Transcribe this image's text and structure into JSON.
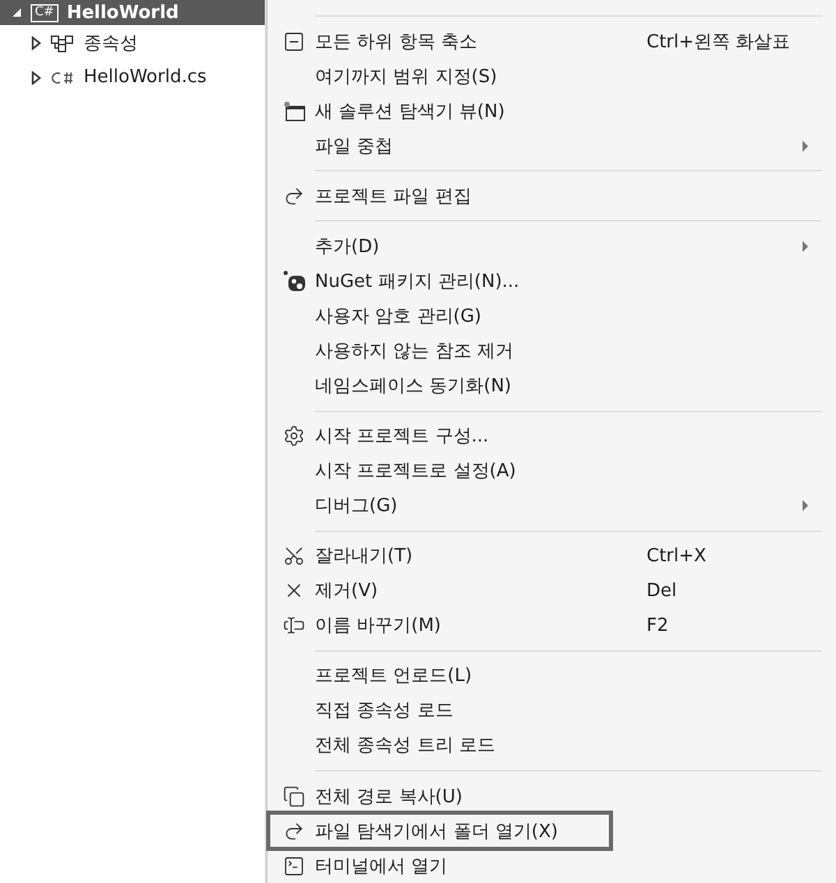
{
  "tree": [
    {
      "label": "HelloWorld",
      "kind": "csproj",
      "badge": "C#",
      "selected": true,
      "expanded": true,
      "children": [
        {
          "label": "종속성",
          "kind": "dependencies",
          "selected": false,
          "expanded": false
        },
        {
          "label": "HelloWorld.cs",
          "kind": "csharp",
          "selected": false,
          "expanded": false
        }
      ]
    }
  ],
  "menu": {
    "groups": [
      [
        {
          "label": "모든 하위 항목 축소",
          "shortcut": "Ctrl+왼쪽 화살표",
          "kind": "collapse"
        },
        {
          "label": "여기까지 범위 지정(S)"
        },
        {
          "label": "새 솔루션 탐색기 뷰(N)",
          "kind": "new-view"
        },
        {
          "label": "파일 중첩",
          "submenu": true
        }
      ],
      [
        {
          "label": "프로젝트 파일 편집",
          "kind": "redo"
        }
      ],
      [
        {
          "label": "추가(D)",
          "submenu": true
        },
        {
          "label": "NuGet 패키지 관리(N)...",
          "kind": "nuget"
        },
        {
          "label": "사용자 암호 관리(G)"
        },
        {
          "label": "사용하지 않는 참조 제거"
        },
        {
          "label": "네임스페이스 동기화(N)"
        }
      ],
      [
        {
          "label": "시작 프로젝트 구성...",
          "kind": "gear"
        },
        {
          "label": "시작 프로젝트로 설정(A)"
        },
        {
          "label": "디버그(G)",
          "submenu": true
        }
      ],
      [
        {
          "label": "잘라내기(T)",
          "shortcut": "Ctrl+X",
          "kind": "cut"
        },
        {
          "label": "제거(V)",
          "shortcut": "Del",
          "kind": "remove"
        },
        {
          "label": "이름 바꾸기(M)",
          "shortcut": "F2",
          "kind": "rename"
        }
      ],
      [
        {
          "label": "프로젝트 언로드(L)"
        },
        {
          "label": "직접 종속성 로드"
        },
        {
          "label": "전체 종속성 트리 로드"
        }
      ],
      [
        {
          "label": "전체 경로 복사(U)",
          "kind": "copy"
        },
        {
          "label": "파일 탐색기에서 폴더 열기(X)",
          "kind": "redo",
          "highlighted": true
        },
        {
          "label": "터미널에서 열기",
          "kind": "terminal"
        }
      ]
    ]
  }
}
